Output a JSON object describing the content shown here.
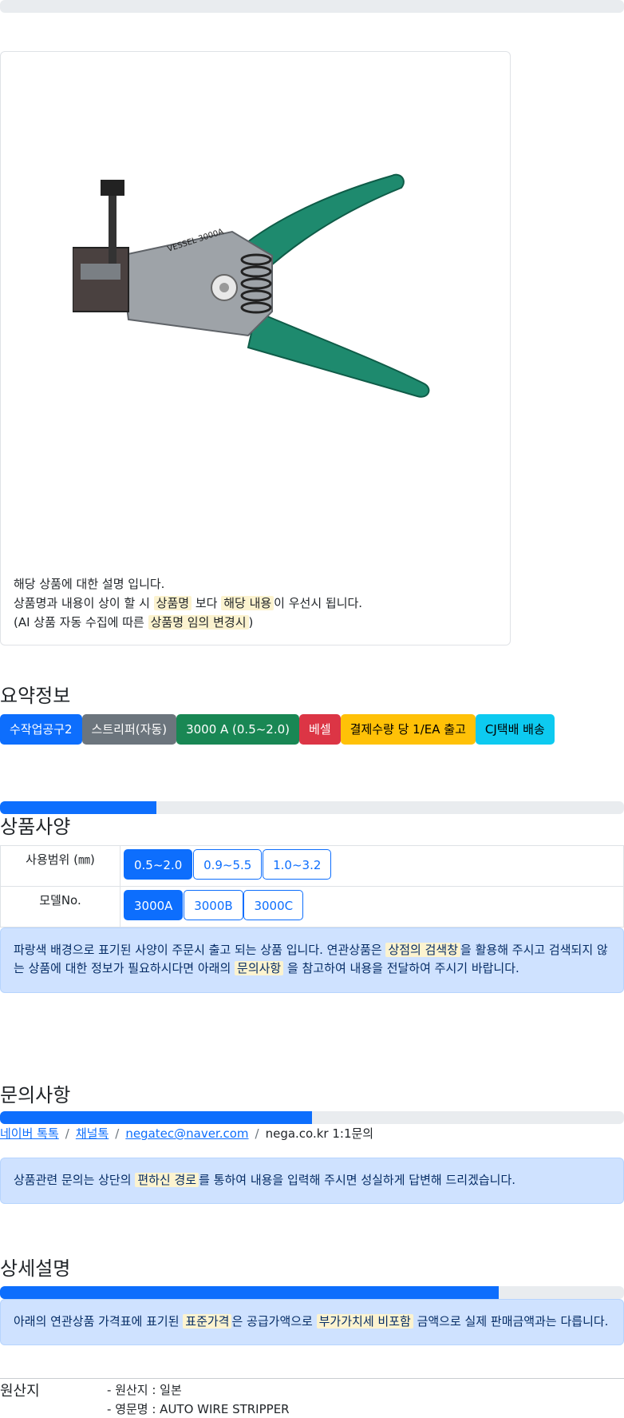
{
  "product": {
    "image_alt": "VESSEL 3000A auto wire stripper",
    "image_print": "VESSEL 3000A",
    "desc_line1": "해당 상품에 대한 설명 입니다.",
    "desc_line2_a": "상품명과 내용이 상이 할 시 ",
    "desc_line2_mark1": "상품명",
    "desc_line2_b": " 보다 ",
    "desc_line2_mark2": "해당 내용",
    "desc_line2_c": "이 우선시 됩니다.",
    "desc_line3_a": "(AI 상품 자동 수집에 따른 ",
    "desc_line3_mark": "상품명 임의 변경시",
    "desc_line3_b": ")"
  },
  "summary": {
    "title": "요약정보",
    "badges": [
      {
        "label": "수작업공구2",
        "color": "#0d6efd"
      },
      {
        "label": "스트리퍼(자동)",
        "color": "#6c757d"
      },
      {
        "label": "3000 A (0.5~2.0)",
        "color": "#198754"
      },
      {
        "label": "베셀",
        "color": "#dc3545"
      },
      {
        "label": "결제수량 당 1/EA 출고",
        "color": "#ffc107"
      },
      {
        "label": "CJ택배 배송",
        "color": "#0dcaf0"
      }
    ]
  },
  "progress": {
    "top": 0,
    "spec": 0.25,
    "inquiry": 0.5,
    "detail": 0.8
  },
  "spec": {
    "title": "상품사양",
    "rows": [
      {
        "label": "사용범위 (㎜)",
        "options": [
          "0.5~2.0",
          "0.9~5.5",
          "1.0~3.2"
        ],
        "selected": 0
      },
      {
        "label": "모델No.",
        "options": [
          "3000A",
          "3000B",
          "3000C"
        ],
        "selected": 0
      }
    ],
    "notice_a": "파랑색 배경으로 표기된 사양이 주문시 출고 되는 상품 입니다. 연관상품은 ",
    "notice_mark1": "상점의 검색창",
    "notice_b": "을 활용해 주시고 검색되지 않는 상품에 대한 정보가 필요하시다면 아래의 ",
    "notice_mark2": "문의사항",
    "notice_c": " 을 참고하여 내용을 전달하여 주시기 바랍니다."
  },
  "inquiry": {
    "title": "문의사항",
    "links": [
      "네이버 톡톡",
      "채널톡",
      "negatec@naver.com"
    ],
    "plain": "nega.co.kr 1:1문의",
    "separator": "/",
    "notice_a": "상품관련 문의는 상단의 ",
    "notice_mark": "편하신 경로",
    "notice_b": "를 통하여 내용을 입력해 주시면 성실하게 답변해 드리겠습니다."
  },
  "detail": {
    "title": "상세설명",
    "notice_a": "아래의 연관상품 가격표에 표기된 ",
    "notice_mark1": "표준가격",
    "notice_b": "은 공급가액으로 ",
    "notice_mark2": "부가가치세 비포함",
    "notice_c": " 금액으로 실제 판매금액과는 다릅니다."
  },
  "origin": {
    "label": "원산지",
    "items": [
      "원산지 : 일본",
      "영문명 : AUTO WIRE STRIPPER"
    ]
  }
}
